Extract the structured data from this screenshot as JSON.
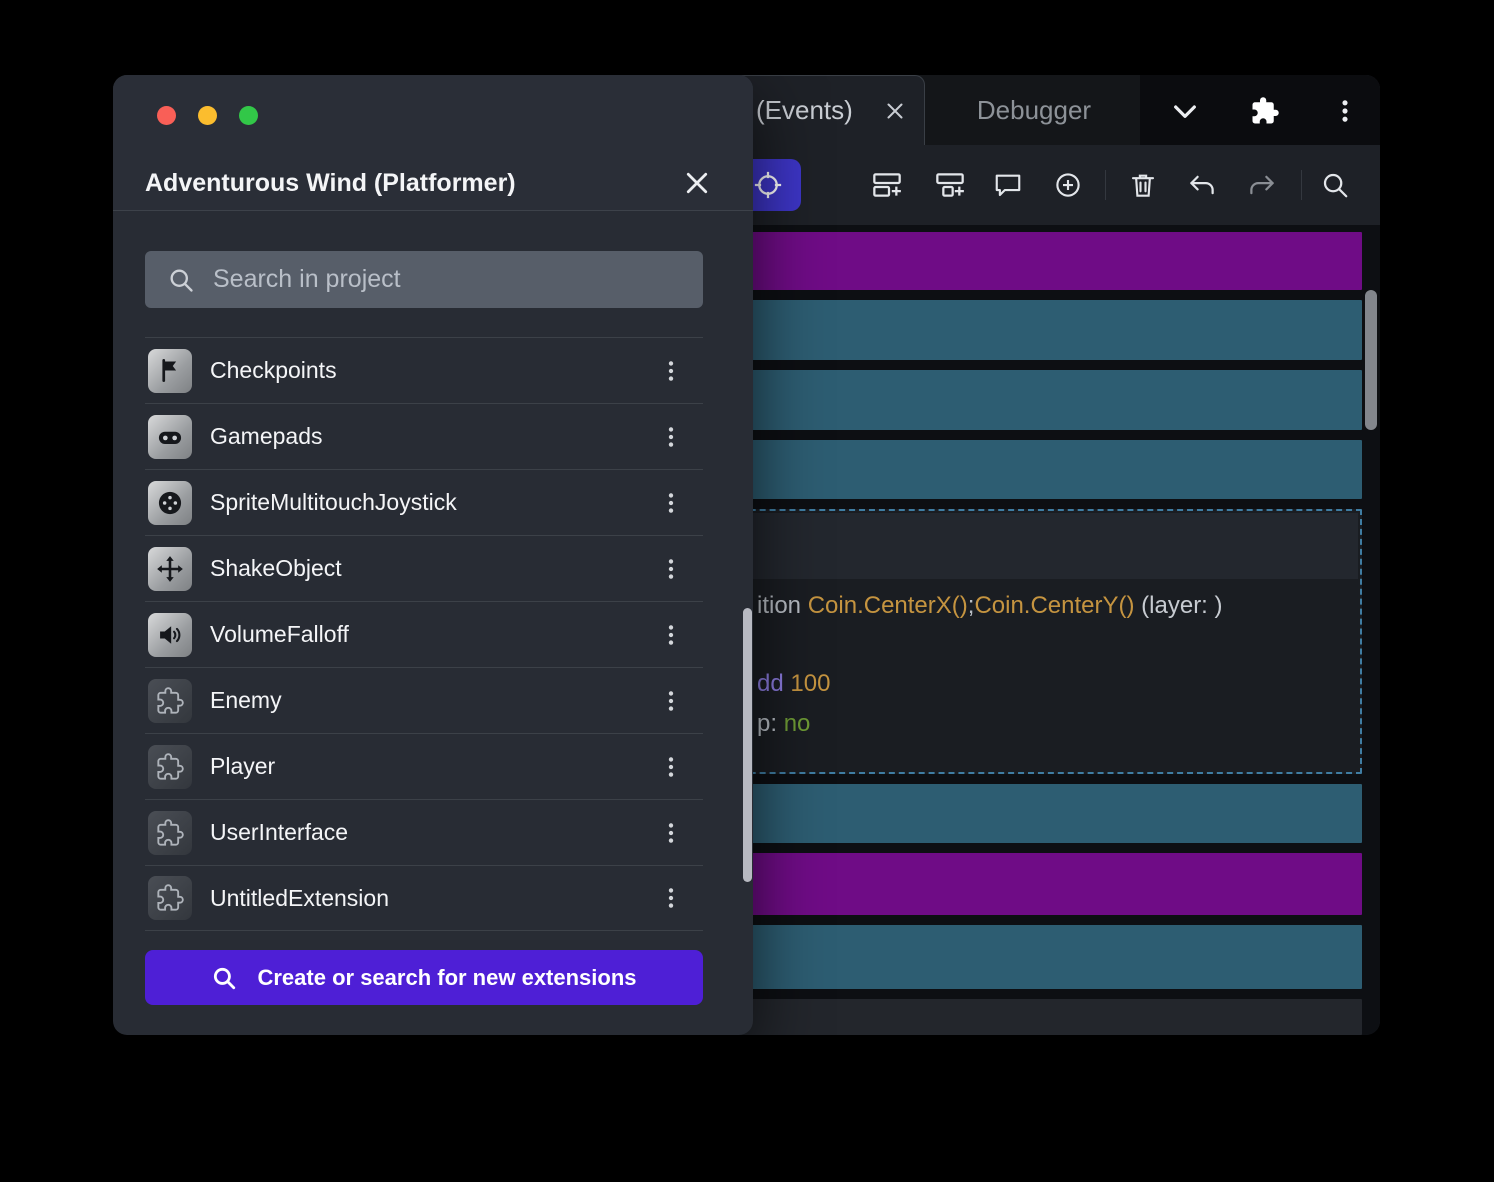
{
  "colors": {
    "accent-purple": "#4e1fd6",
    "row-purple": "#6f0c86",
    "row-teal": "#2d5d72",
    "selected-border": "#3f7da3",
    "toolbar-selected": "#3d35c6",
    "traffic-red": "#f95f57",
    "traffic-yellow": "#fbbd2e",
    "traffic-green": "#32c748"
  },
  "dialog": {
    "title": "Adventurous Wind (Platformer)",
    "search_placeholder": "Search in project",
    "items": [
      {
        "label": "Checkpoints",
        "icon": "flag"
      },
      {
        "label": "Gamepads",
        "icon": "gamepad"
      },
      {
        "label": "SpriteMultitouchJoystick",
        "icon": "joystick"
      },
      {
        "label": "ShakeObject",
        "icon": "move"
      },
      {
        "label": "VolumeFalloff",
        "icon": "speaker"
      },
      {
        "label": "Enemy",
        "icon": "puzzle"
      },
      {
        "label": "Player",
        "icon": "puzzle"
      },
      {
        "label": "UserInterface",
        "icon": "puzzle"
      },
      {
        "label": "UntitledExtension",
        "icon": "puzzle"
      }
    ],
    "cta_label": "Create or search for new extensions"
  },
  "editor": {
    "tabs": {
      "events": "(Events)",
      "debugger": "Debugger"
    },
    "code": {
      "line1": [
        {
          "text": "ition ",
          "color": "#b9bec5"
        },
        {
          "text": "Coin.CenterX()",
          "color": "#c59440"
        },
        {
          "text": ";",
          "color": "#b9bec5"
        },
        {
          "text": "Coin.CenterY()",
          "color": "#c59440"
        },
        {
          "text": " (layer: )",
          "color": "#c7cbd1"
        }
      ],
      "line2": [
        {
          "text": "dd ",
          "color": "#8c7ce0"
        },
        {
          "text": "100",
          "color": "#c59440"
        }
      ],
      "line3": [
        {
          "text": "p: ",
          "color": "#b9bec5"
        },
        {
          "text": "no",
          "color": "#6e9b35"
        }
      ]
    }
  }
}
